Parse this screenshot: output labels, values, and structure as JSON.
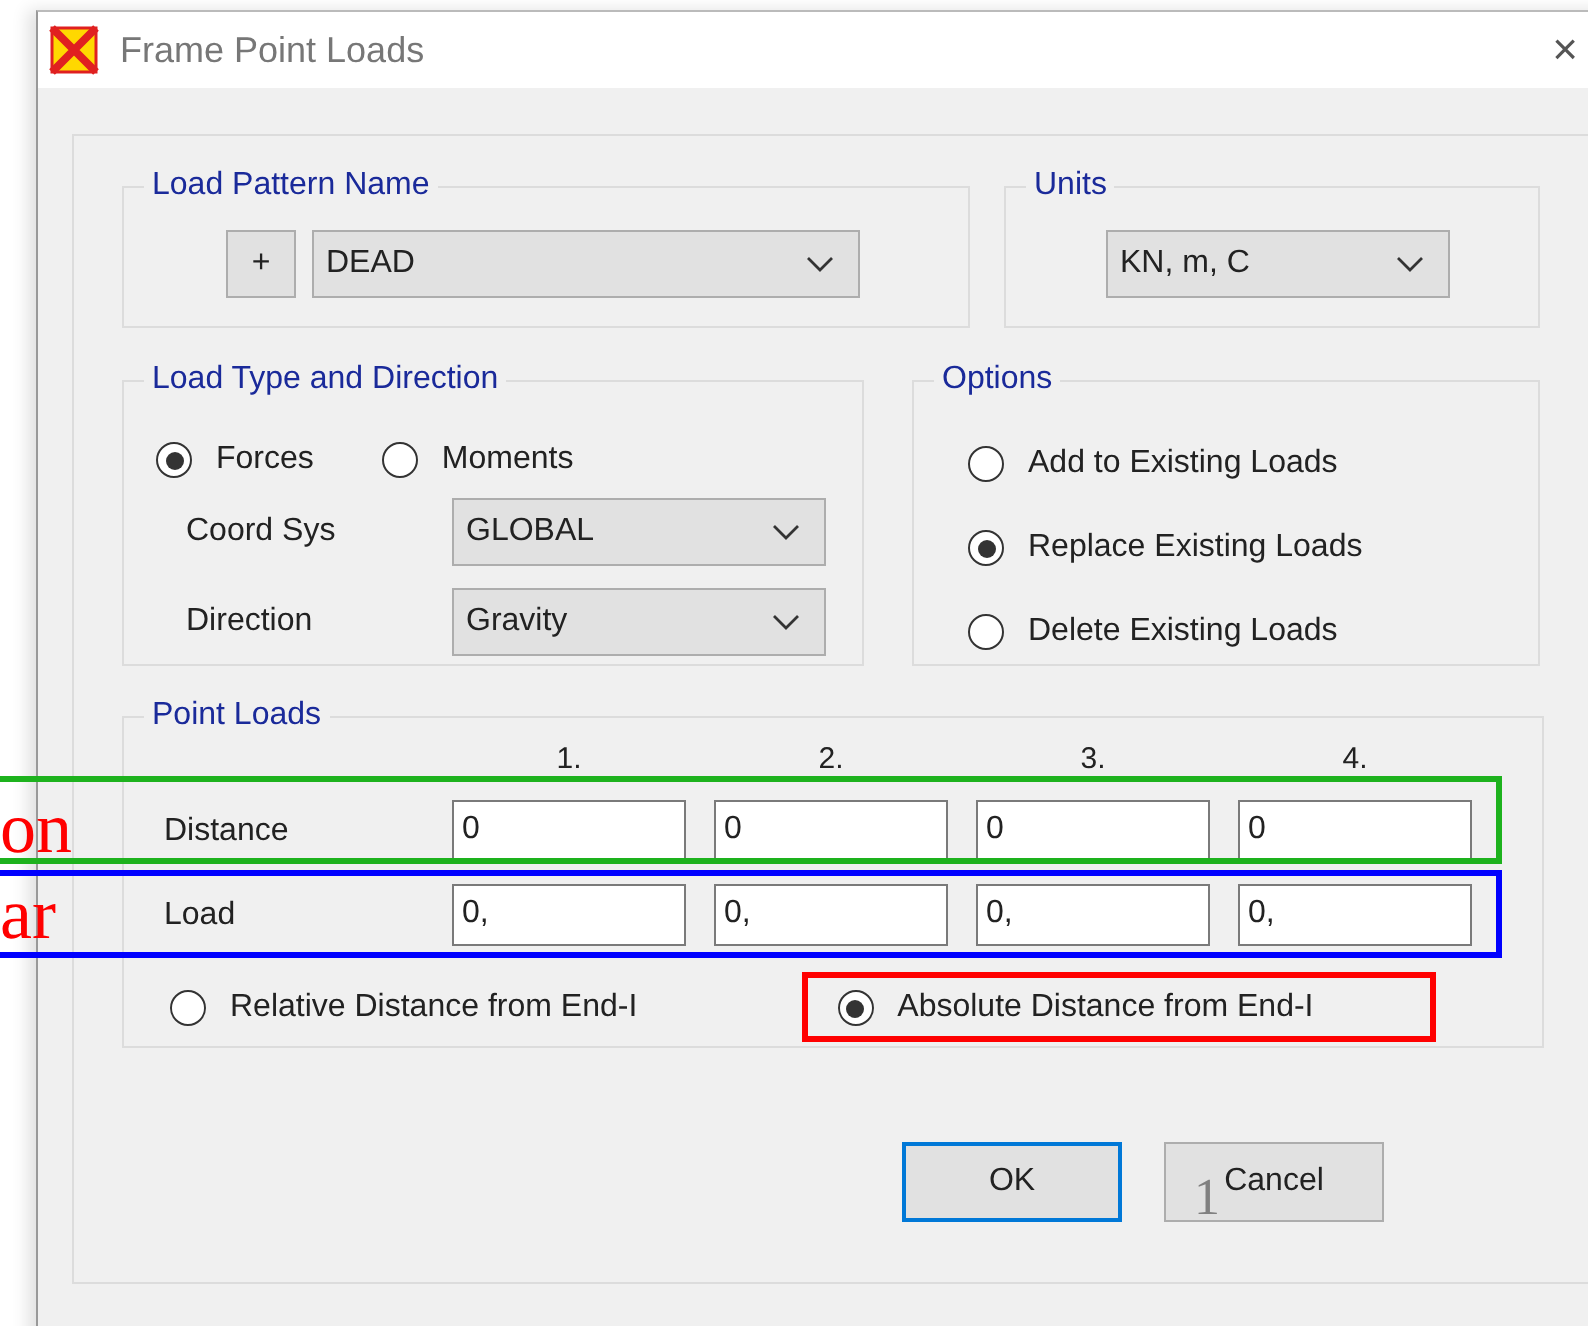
{
  "window": {
    "title": "Frame Point Loads",
    "close": "×"
  },
  "load_pattern": {
    "title": "Load Pattern Name",
    "add_button": "+",
    "value": "DEAD"
  },
  "units": {
    "title": "Units",
    "value": "KN, m, C"
  },
  "load_type": {
    "title": "Load Type and Direction",
    "options": [
      {
        "label": "Forces",
        "selected": true
      },
      {
        "label": "Moments",
        "selected": false
      }
    ],
    "fields": [
      {
        "label": "Coord Sys",
        "value": "GLOBAL"
      },
      {
        "label": "Direction",
        "value": "Gravity"
      }
    ]
  },
  "options": {
    "title": "Options",
    "items": [
      {
        "label": "Add to Existing Loads",
        "selected": false
      },
      {
        "label": "Replace Existing Loads",
        "selected": true
      },
      {
        "label": "Delete Existing Loads",
        "selected": false
      }
    ]
  },
  "point_loads": {
    "title": "Point Loads",
    "columns": [
      "1.",
      "2.",
      "3.",
      "4."
    ],
    "rows": [
      {
        "label": "Distance",
        "values": [
          "0",
          "0",
          "0",
          "0"
        ]
      },
      {
        "label": "Load",
        "values": [
          "0,",
          "0,",
          "0,",
          "0,"
        ]
      }
    ],
    "distance_modes": [
      {
        "label": "Relative Distance from End-I",
        "selected": false
      },
      {
        "label": "Absolute Distance from End-I",
        "selected": true
      }
    ]
  },
  "buttons": [
    {
      "label": "OK",
      "focused": true
    },
    {
      "label": "Cancel",
      "focused": false
    }
  ],
  "annotations": [
    {
      "kind": "box",
      "color": "#1db21d"
    },
    {
      "kind": "box",
      "color": "#0000ff"
    },
    {
      "kind": "box",
      "color": "#ff0000"
    },
    {
      "kind": "text",
      "text": "on",
      "color": "#ff0000"
    },
    {
      "kind": "text",
      "text": "ar",
      "color": "#ff0000"
    },
    {
      "kind": "text",
      "text": "1",
      "color": "#808080"
    }
  ]
}
